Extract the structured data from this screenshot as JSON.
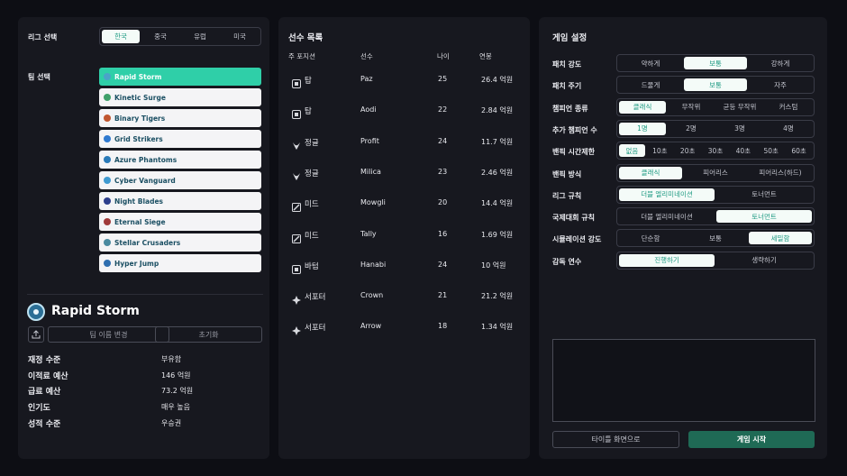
{
  "league": {
    "label": "리그 선택",
    "options": [
      "한국",
      "중국",
      "유럽",
      "미국"
    ],
    "selected": 0
  },
  "team_select": {
    "label": "팀 선택",
    "teams": [
      {
        "name": "Rapid Storm",
        "color": "#4aa3c9"
      },
      {
        "name": "Kinetic Surge",
        "color": "#3fa06a"
      },
      {
        "name": "Binary Tigers",
        "color": "#c0562f"
      },
      {
        "name": "Grid Strikers",
        "color": "#2f7ad0"
      },
      {
        "name": "Azure Phantoms",
        "color": "#2a7ab8"
      },
      {
        "name": "Cyber Vanguard",
        "color": "#3f9ad0"
      },
      {
        "name": "Night Blades",
        "color": "#2c3e8c"
      },
      {
        "name": "Eternal Siege",
        "color": "#a03a3a"
      },
      {
        "name": "Stellar Crusaders",
        "color": "#4a8aa0"
      },
      {
        "name": "Hyper Jump",
        "color": "#2f6fb0"
      }
    ],
    "selected": 0
  },
  "team_detail": {
    "name": "Rapid Storm",
    "rename_button": "팀 이름 변경",
    "reset_button": "초기화",
    "stats": [
      {
        "label": "재정 수준",
        "value": "부유함"
      },
      {
        "label": "이적료 예산",
        "value": "146 억원"
      },
      {
        "label": "급료 예산",
        "value": "73.2 억원"
      },
      {
        "label": "인기도",
        "value": "매우 높음"
      },
      {
        "label": "성적 수준",
        "value": "우승권"
      }
    ]
  },
  "roster": {
    "title": "선수 목록",
    "headers": {
      "position": "주 포지션",
      "player": "선수",
      "age": "나이",
      "salary": "연봉"
    },
    "rows": [
      {
        "icon": "top-icon",
        "position": "탑",
        "player": "Paz",
        "age": "25",
        "salary": "26.4 억원"
      },
      {
        "icon": "top-icon",
        "position": "탑",
        "player": "Aodi",
        "age": "22",
        "salary": "2.84 억원"
      },
      {
        "icon": "jungle-icon",
        "position": "정글",
        "player": "Profit",
        "age": "24",
        "salary": "11.7 억원"
      },
      {
        "icon": "jungle-icon",
        "position": "정글",
        "player": "Milica",
        "age": "23",
        "salary": "2.46 억원"
      },
      {
        "icon": "mid-icon",
        "position": "미드",
        "player": "Mowgli",
        "age": "20",
        "salary": "14.4 억원"
      },
      {
        "icon": "mid-icon",
        "position": "미드",
        "player": "Tally",
        "age": "16",
        "salary": "1.69 억원"
      },
      {
        "icon": "bottom-icon",
        "position": "바텀",
        "player": "Hanabi",
        "age": "24",
        "salary": "10 억원"
      },
      {
        "icon": "support-icon",
        "position": "서포터",
        "player": "Crown",
        "age": "21",
        "salary": "21.2 억원"
      },
      {
        "icon": "support-icon",
        "position": "서포터",
        "player": "Arrow",
        "age": "18",
        "salary": "1.34 억원"
      }
    ]
  },
  "settings": {
    "title": "게임 설정",
    "rows": [
      {
        "label": "패치 강도",
        "options": [
          "약하게",
          "보통",
          "강하게"
        ],
        "selected": 1
      },
      {
        "label": "패치 주기",
        "options": [
          "드물게",
          "보통",
          "자주"
        ],
        "selected": 1
      },
      {
        "label": "챔피언 종류",
        "options": [
          "클래식",
          "무작위",
          "균등 무작위",
          "커스텀"
        ],
        "selected": 0
      },
      {
        "label": "추가 챔피언 수",
        "options": [
          "1명",
          "2명",
          "3명",
          "4명"
        ],
        "selected": 0
      },
      {
        "label": "밴픽 시간제한",
        "options": [
          "없음",
          "10초",
          "20초",
          "30초",
          "40초",
          "50초",
          "60초"
        ],
        "selected": 0
      },
      {
        "label": "밴픽 방식",
        "options": [
          "클래식",
          "피어리스",
          "피어리스(하드)"
        ],
        "selected": 0
      },
      {
        "label": "리그 규칙",
        "options": [
          "더블 엘리미네이션",
          "토너먼트"
        ],
        "selected": 0
      },
      {
        "label": "국제대회 규칙",
        "options": [
          "더블 엘리미네이션",
          "토너먼트"
        ],
        "selected": 1
      },
      {
        "label": "시뮬레이션 강도",
        "options": [
          "단순함",
          "보통",
          "세밀함"
        ],
        "selected": 2
      },
      {
        "label": "감독 연수",
        "options": [
          "진행하기",
          "생략하기"
        ],
        "selected": 0
      }
    ],
    "title_screen_button": "타이틀 화면으로",
    "start_button": "게임 시작"
  },
  "colors": {
    "accent": "#2fcfa8",
    "start_button": "#1f6a55"
  }
}
